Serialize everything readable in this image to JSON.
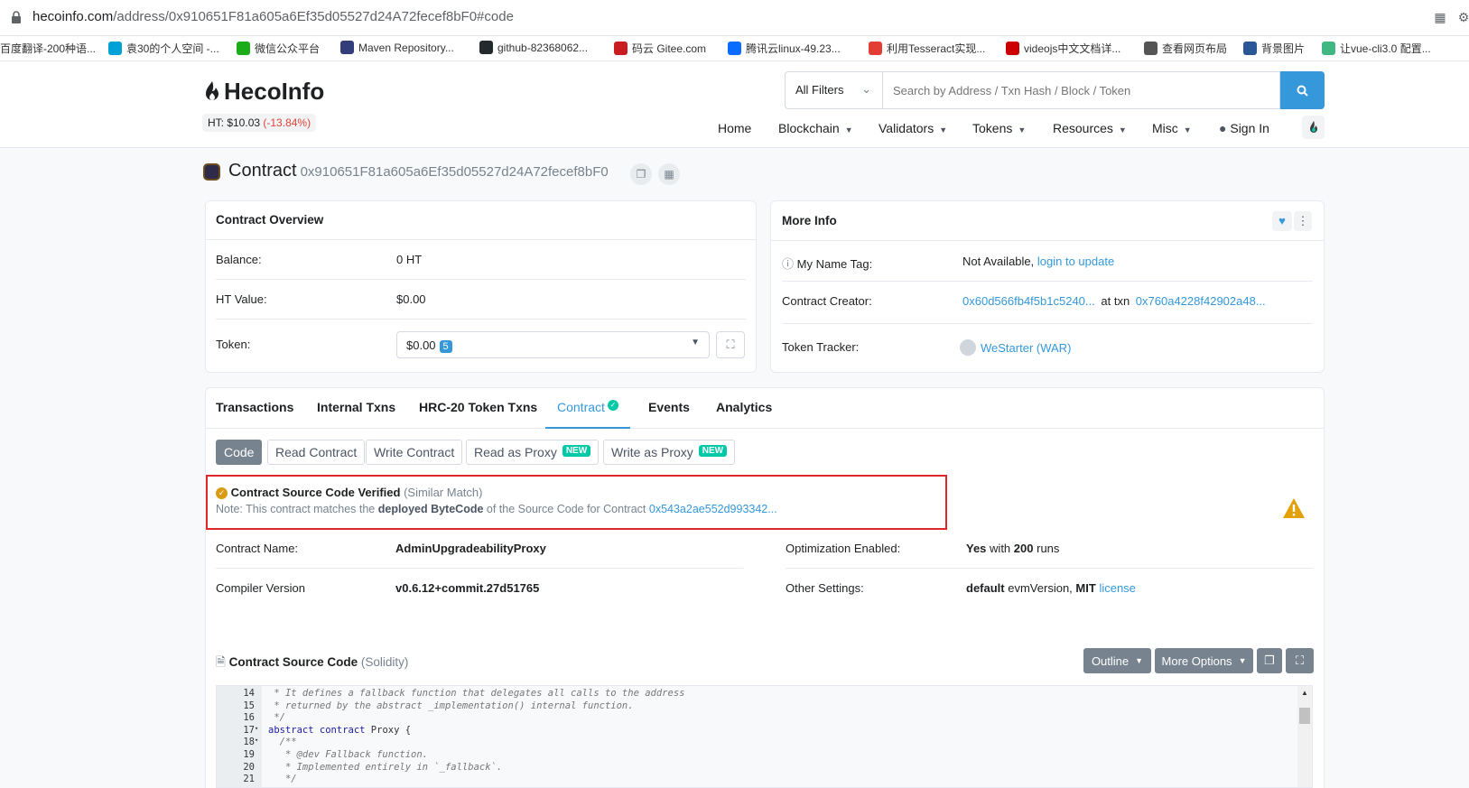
{
  "browser": {
    "url_host": "hecoinfo.com",
    "url_path": "/address/0x910651F81a605a6Ef35d05527d24A72fecef8bF0#code",
    "bookmarks": [
      {
        "label": "百度翻译-200种语...",
        "icon": "translate-icon",
        "color": "#2b6de6"
      },
      {
        "label": "袁30的个人空间 -...",
        "icon": "bilibili-icon",
        "color": "#00a1d6"
      },
      {
        "label": "微信公众平台",
        "icon": "wechat-icon",
        "color": "#1aad19"
      },
      {
        "label": "Maven Repository...",
        "icon": "maven-icon",
        "color": "#333d7a"
      },
      {
        "label": "github-82368062...",
        "icon": "github-icon",
        "color": "#24292e"
      },
      {
        "label": "码云 Gitee.com",
        "icon": "gitee-icon",
        "color": "#c71d23"
      },
      {
        "label": "腾讯云linux-49.23...",
        "icon": "cloud-icon",
        "color": "#0a6cff"
      },
      {
        "label": "利用Tesseract实现...",
        "icon": "csdn-icon",
        "color": "#e33e33"
      },
      {
        "label": "videojs中文文档详...",
        "icon": "csdn-icon",
        "color": "#c00"
      },
      {
        "label": "查看网页布局",
        "icon": "globe-icon",
        "color": "#555"
      },
      {
        "label": "背景图片",
        "icon": "image-icon",
        "color": "#2b5797"
      },
      {
        "label": "让vue-cli3.0 配置...",
        "icon": "vue-icon",
        "color": "#41b883"
      }
    ]
  },
  "header": {
    "brand": "HecoInfo",
    "price_label": "HT: $10.03",
    "price_change": "(-13.84%)",
    "filter_label": "All Filters",
    "search_placeholder": "Search by Address / Txn Hash / Block / Token",
    "nav": {
      "home": "Home",
      "blockchain": "Blockchain",
      "validators": "Validators",
      "tokens": "Tokens",
      "resources": "Resources",
      "misc": "Misc",
      "sign_in": "Sign In"
    }
  },
  "title": {
    "label": "Contract",
    "address": "0x910651F81a605a6Ef35d05527d24A72fecef8bF0"
  },
  "overview": {
    "heading": "Contract Overview",
    "balance_label": "Balance:",
    "balance_value": "0 HT",
    "htvalue_label": "HT Value:",
    "htvalue_value": "$0.00",
    "token_label": "Token:",
    "token_value": "$0.00",
    "token_count": "5"
  },
  "moreinfo": {
    "heading": "More Info",
    "nametag_label": "My Name Tag:",
    "nametag_value": "Not Available,",
    "nametag_link": "login to update",
    "creator_label": "Contract Creator:",
    "creator_addr": "0x60d566fb4f5b1c5240...",
    "creator_at": "at txn",
    "creator_txn": "0x760a4228f42902a48...",
    "tracker_label": "Token Tracker:",
    "tracker_value": "WeStarter (WAR)"
  },
  "tabs": {
    "transactions": "Transactions",
    "internal": "Internal Txns",
    "hrc20": "HRC-20 Token Txns",
    "contract": "Contract",
    "events": "Events",
    "analytics": "Analytics"
  },
  "subtabs": {
    "code": "Code",
    "read": "Read Contract",
    "write": "Write Contract",
    "read_proxy": "Read as Proxy",
    "write_proxy": "Write as Proxy",
    "new_badge": "NEW"
  },
  "verified": {
    "title": "Contract Source Code Verified",
    "match": "(Similar Match)",
    "note_pre": "Note: This contract matches the",
    "note_bold": "deployed ByteCode",
    "note_post": "of the Source Code for Contract",
    "note_link": "0x543a2ae552d993342..."
  },
  "details": {
    "name_label": "Contract Name:",
    "name_value": "AdminUpgradeabilityProxy",
    "compiler_label": "Compiler Version",
    "compiler_value": "v0.6.12+commit.27d51765",
    "opt_label": "Optimization Enabled:",
    "opt_yes": "Yes",
    "opt_with": "with",
    "opt_runs": "200",
    "opt_runs_label": "runs",
    "other_label": "Other Settings:",
    "other_default": "default",
    "other_evm": "evmVersion,",
    "other_mit": "MIT",
    "other_license": "license"
  },
  "source": {
    "heading": "Contract Source Code",
    "lang": "(Solidity)",
    "outline": "Outline",
    "more_options": "More Options",
    "lines": [
      {
        "n": "14",
        "text": " * It defines a fallback function that delegates all calls to the address",
        "type": "comment"
      },
      {
        "n": "15",
        "text": " * returned by the abstract _implementation() internal function.",
        "type": "comment"
      },
      {
        "n": "16",
        "text": " */",
        "type": "comment"
      },
      {
        "n": "17",
        "text": "abstract contract Proxy {",
        "type": "code"
      },
      {
        "n": "18",
        "text": "  /**",
        "type": "comment"
      },
      {
        "n": "19",
        "text": "   * @dev Fallback function.",
        "type": "comment"
      },
      {
        "n": "20",
        "text": "   * Implemented entirely in `_fallback`.",
        "type": "comment"
      },
      {
        "n": "21",
        "text": "   */",
        "type": "comment"
      }
    ]
  }
}
